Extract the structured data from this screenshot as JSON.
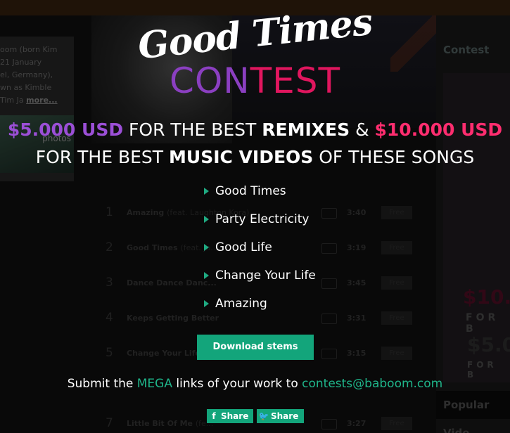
{
  "background": {
    "bio_lines": [
      "oom (born Kim",
      "21 January",
      "el, Germany),",
      "wn as Kimble",
      "Tim Ja"
    ],
    "bio_more": "more...",
    "photos_label": "photos",
    "right_panel_title": "Contest",
    "right_big_1": "$10.",
    "right_forb_1": "FOR B",
    "right_big_2": "$5.0",
    "right_forb_2": "FOR B",
    "popular_title": "Popular Vide",
    "tracks": [
      {
        "num": "1",
        "name": "Amazing",
        "feat": "(feat. Laughton Kora)",
        "time": "3:40",
        "btn": "Free"
      },
      {
        "num": "2",
        "name": "Good Times",
        "feat": "(feat. Ja...",
        "time": "3:19",
        "btn": "Free"
      },
      {
        "num": "3",
        "name": "Dance Dance Danc...",
        "feat": "",
        "time": "3:45",
        "btn": "Free"
      },
      {
        "num": "4",
        "name": "Keeps Getting Better",
        "feat": "",
        "time": "3:31",
        "btn": "Free"
      },
      {
        "num": "5",
        "name": "Change Your Life",
        "feat": "",
        "time": "3:15",
        "btn": "Free"
      },
      {
        "num": "7",
        "name": "Little Bit Of Me",
        "feat": "(fe...",
        "time": "3:27",
        "btn": "Free"
      }
    ]
  },
  "modal": {
    "logo_top": "Good Times",
    "logo_bottom_part1": "CON",
    "logo_bottom_part2": "TEST",
    "headline1": {
      "amount1": "$5.000 USD",
      "text1": " FOR THE BEST ",
      "emph1": "REMIXES",
      "text2": " & ",
      "amount2": "$10.000 USD"
    },
    "headline2": {
      "text1": "FOR THE BEST ",
      "emph": "MUSIC VIDEOS",
      "text2": " OF THESE SONGS"
    },
    "songs": [
      "Good Times",
      "Party Electricity",
      "Good Life",
      "Change Your Life",
      "Amazing"
    ],
    "download_button": "Download stems",
    "submit": {
      "text1": "Submit the ",
      "link1": "MEGA",
      "text2": " links of your work to ",
      "email": "contests@baboom.com"
    },
    "share_facebook": "Share",
    "share_twitter": "Share"
  },
  "colors": {
    "purple": "#9b4fd6",
    "pink": "#ff2d6f",
    "green": "#13a57b"
  }
}
